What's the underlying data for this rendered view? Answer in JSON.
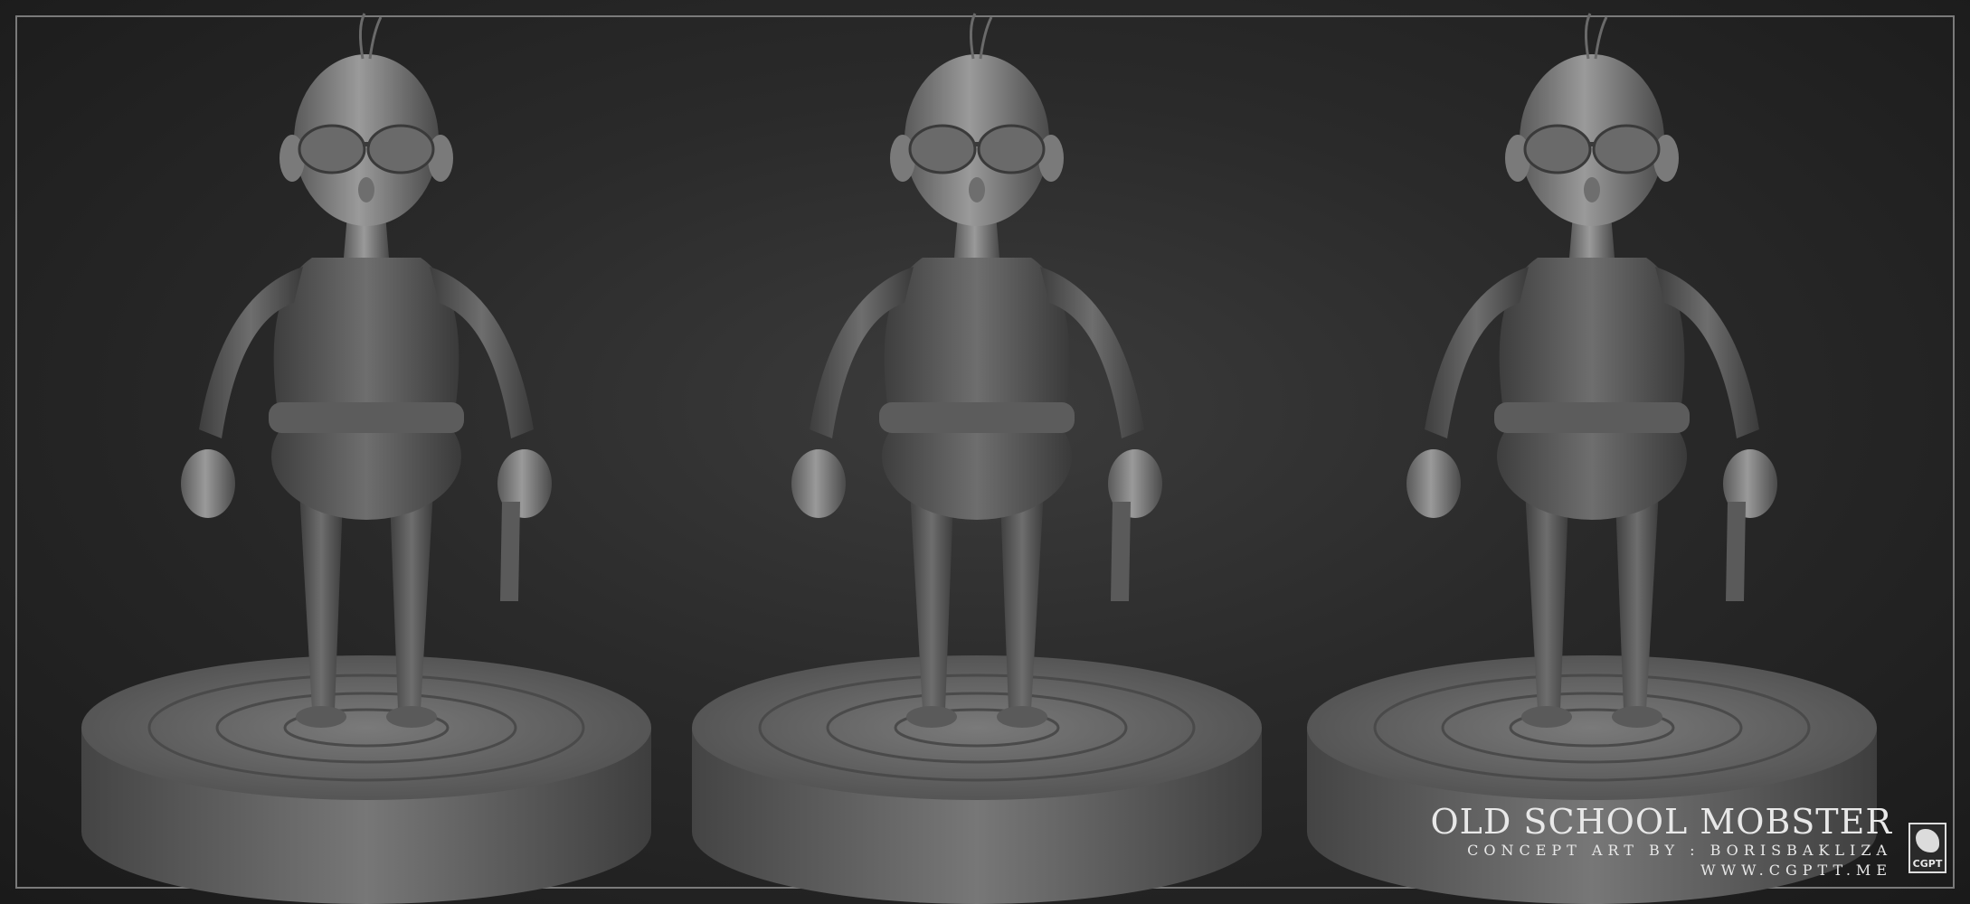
{
  "caption": {
    "title": "OLD SCHOOL MOBSTER",
    "credit": "CONCEPT ART BY : BORISBAKLIZA",
    "site": "WWW.CGPTT.ME"
  },
  "badge": {
    "label": "CGPT"
  },
  "figures": [
    {
      "view": "three-quarter-left"
    },
    {
      "view": "front"
    },
    {
      "view": "three-quarter-right"
    }
  ]
}
